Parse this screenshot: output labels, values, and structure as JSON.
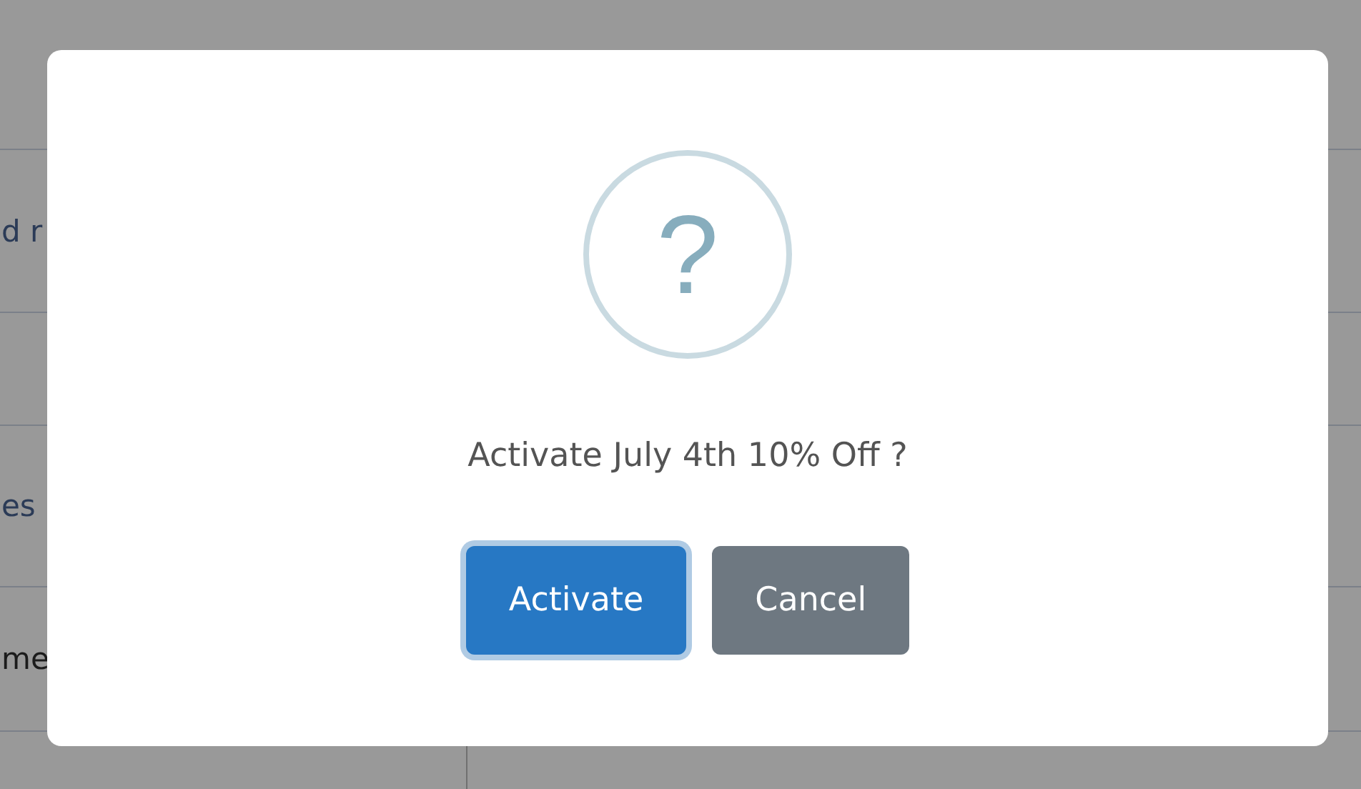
{
  "background_rows": [
    {
      "text": "d r",
      "kind": "link"
    },
    {
      "text": ""
    },
    {
      "text": "es",
      "kind": "link"
    },
    {
      "text": "me",
      "kind": "plain"
    }
  ],
  "dialog": {
    "message": "Activate July 4th 10% Off ?",
    "icon": "?",
    "buttons": [
      {
        "label": "Activate",
        "kind": "primary",
        "focused": true
      },
      {
        "label": "Cancel",
        "kind": "secondary",
        "focused": false
      }
    ]
  }
}
